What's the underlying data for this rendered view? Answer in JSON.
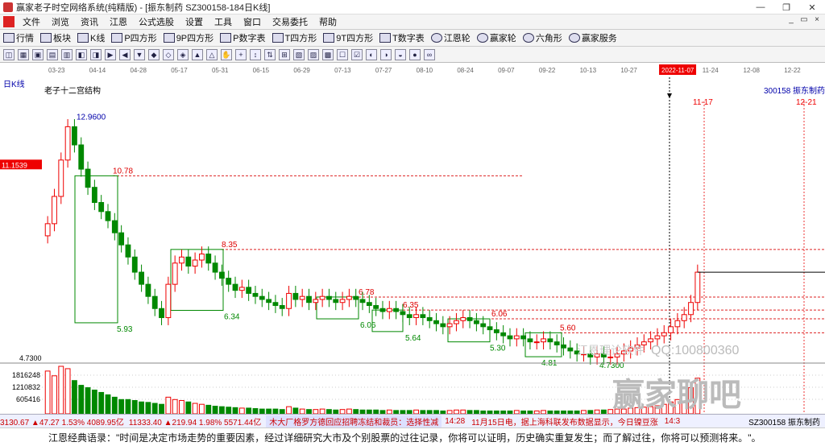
{
  "window": {
    "title": "赢家老子时空网络系统(纯精版) - [振东制药  SZ300158-184日K线]",
    "minimize": "—",
    "restore": "❐",
    "close": "✕"
  },
  "menu": [
    "文件",
    "浏览",
    "资讯",
    "江恩",
    "公式选股",
    "设置",
    "工具",
    "窗口",
    "交易委托",
    "帮助"
  ],
  "toolbar1": [
    "行情",
    "板块",
    "K线",
    "P四方形",
    "9P四方形",
    "P数字表",
    "T四方形",
    "9T四方形",
    "T数字表",
    "江恩轮",
    "赢家轮",
    "六角形",
    "赢家服务"
  ],
  "toolbar1_icons": [
    "market-icon",
    "sector-icon",
    "kline-icon",
    "p-square-icon",
    "9p-square-icon",
    "p-table-icon",
    "t-square-icon",
    "9t-square-icon",
    "t-table-icon",
    "gann-wheel-icon",
    "winner-wheel-icon",
    "hexagon-icon",
    "service-icon"
  ],
  "chart_data": {
    "type": "candlestick",
    "period_label": "日K线",
    "stock_code": "300158",
    "stock_name": "振东制药",
    "annotation_title": "老子十二宫结构",
    "current_price_label": "11.1539",
    "date_ticks": [
      "03-23",
      "04-14",
      "04-28",
      "05-17",
      "05-31",
      "06-15",
      "06-29",
      "07-13",
      "07-27",
      "08-10",
      "08-24",
      "09-07",
      "09-22",
      "10-13",
      "10-27",
      "2022-11-07",
      "11-24",
      "12-08",
      "12-22"
    ],
    "highlight_date": "2022-11-07",
    "future_dates": [
      "11-17",
      "12-21"
    ],
    "price_levels": [
      {
        "label": "12.9600",
        "value": 12.96
      },
      {
        "label": "10.78",
        "value": 10.78
      },
      {
        "label": "8.35",
        "value": 8.35
      },
      {
        "label": "6.78",
        "value": 6.78
      },
      {
        "label": "6.35",
        "value": 6.35
      },
      {
        "label": "6.06",
        "value": 6.06
      },
      {
        "label": "5.60",
        "value": 5.6
      }
    ],
    "low_labels": [
      "5.93",
      "6.34",
      "6.06",
      "5.64",
      "5.30",
      "4.81",
      "4.7300"
    ],
    "bottom_price_label": "4.7300",
    "ylim": [
      4.6,
      13.5
    ],
    "volume_ticks": [
      "1816248",
      "1210832",
      "605416"
    ],
    "closes": [
      9.2,
      10.1,
      11.3,
      12.4,
      11.8,
      11.0,
      10.4,
      9.9,
      9.6,
      9.3,
      8.9,
      8.5,
      8.1,
      7.6,
      7.2,
      6.8,
      6.4,
      6.1,
      7.2,
      7.9,
      8.1,
      7.8,
      8.0,
      8.2,
      7.9,
      7.6,
      7.4,
      7.2,
      7.0,
      7.1,
      6.9,
      6.8,
      6.7,
      6.6,
      6.5,
      6.4,
      6.9,
      6.7,
      6.8,
      6.6,
      6.7,
      6.8,
      6.7,
      6.6,
      6.7,
      6.8,
      6.7,
      6.6,
      6.5,
      6.4,
      6.3,
      6.4,
      6.3,
      6.2,
      6.1,
      6.2,
      6.1,
      6.0,
      5.9,
      5.8,
      5.9,
      6.0,
      6.1,
      6.0,
      5.9,
      5.8,
      5.7,
      5.6,
      5.5,
      5.4,
      5.5,
      5.4,
      5.3,
      5.3,
      5.4,
      5.3,
      5.2,
      5.1,
      5.0,
      4.9,
      4.9,
      4.8,
      4.9,
      4.8,
      4.8,
      4.9,
      5.0,
      5.1,
      5.2,
      5.3,
      5.4,
      5.5,
      5.6,
      5.8,
      6.0,
      6.2,
      6.6,
      7.6
    ],
    "volumes": [
      0.9,
      0.8,
      1.0,
      0.95,
      0.7,
      0.6,
      0.55,
      0.5,
      0.45,
      0.4,
      0.35,
      0.3,
      0.3,
      0.28,
      0.25,
      0.24,
      0.22,
      0.2,
      0.35,
      0.3,
      0.28,
      0.25,
      0.22,
      0.2,
      0.18,
      0.16,
      0.15,
      0.14,
      0.13,
      0.12,
      0.12,
      0.11,
      0.1,
      0.1,
      0.1,
      0.09,
      0.15,
      0.12,
      0.1,
      0.09,
      0.09,
      0.1,
      0.09,
      0.08,
      0.09,
      0.1,
      0.09,
      0.08,
      0.08,
      0.08,
      0.07,
      0.08,
      0.07,
      0.07,
      0.07,
      0.08,
      0.07,
      0.07,
      0.07,
      0.06,
      0.07,
      0.08,
      0.08,
      0.07,
      0.07,
      0.06,
      0.06,
      0.06,
      0.06,
      0.06,
      0.07,
      0.06,
      0.06,
      0.06,
      0.07,
      0.06,
      0.06,
      0.06,
      0.06,
      0.06,
      0.07,
      0.07,
      0.08,
      0.08,
      0.09,
      0.1,
      0.1,
      0.12,
      0.13,
      0.14,
      0.15,
      0.17,
      0.2,
      0.25,
      0.3,
      0.4,
      0.55,
      0.75
    ],
    "watermark_qq": "QQ:100800360",
    "watermark_text": "江恩理论软件",
    "watermark_logo": "赢家聊吧"
  },
  "ticker": {
    "sh_index": "3130.67 ▲47.27 1.53% 4089.95亿",
    "sz_index": "11333.40 ▲219.94 1.98% 5571.44亿",
    "news1": "木大厂格罗方德回应招聘冻结和裁员：选择性减",
    "time": "14:28",
    "news2": "11月15日电，据上海科联发布数据显示，今日镍豆涨",
    "time2": "14:3",
    "stock": "SZ300158 振东制药"
  },
  "quote": "江恩经典语录：\"时间是决定市场走势的重要因素，经过详细研究大市及个别股票的过往记录，你将可以证明，历史确实重复发生；而了解过往，你将可以预测将来。\"。"
}
